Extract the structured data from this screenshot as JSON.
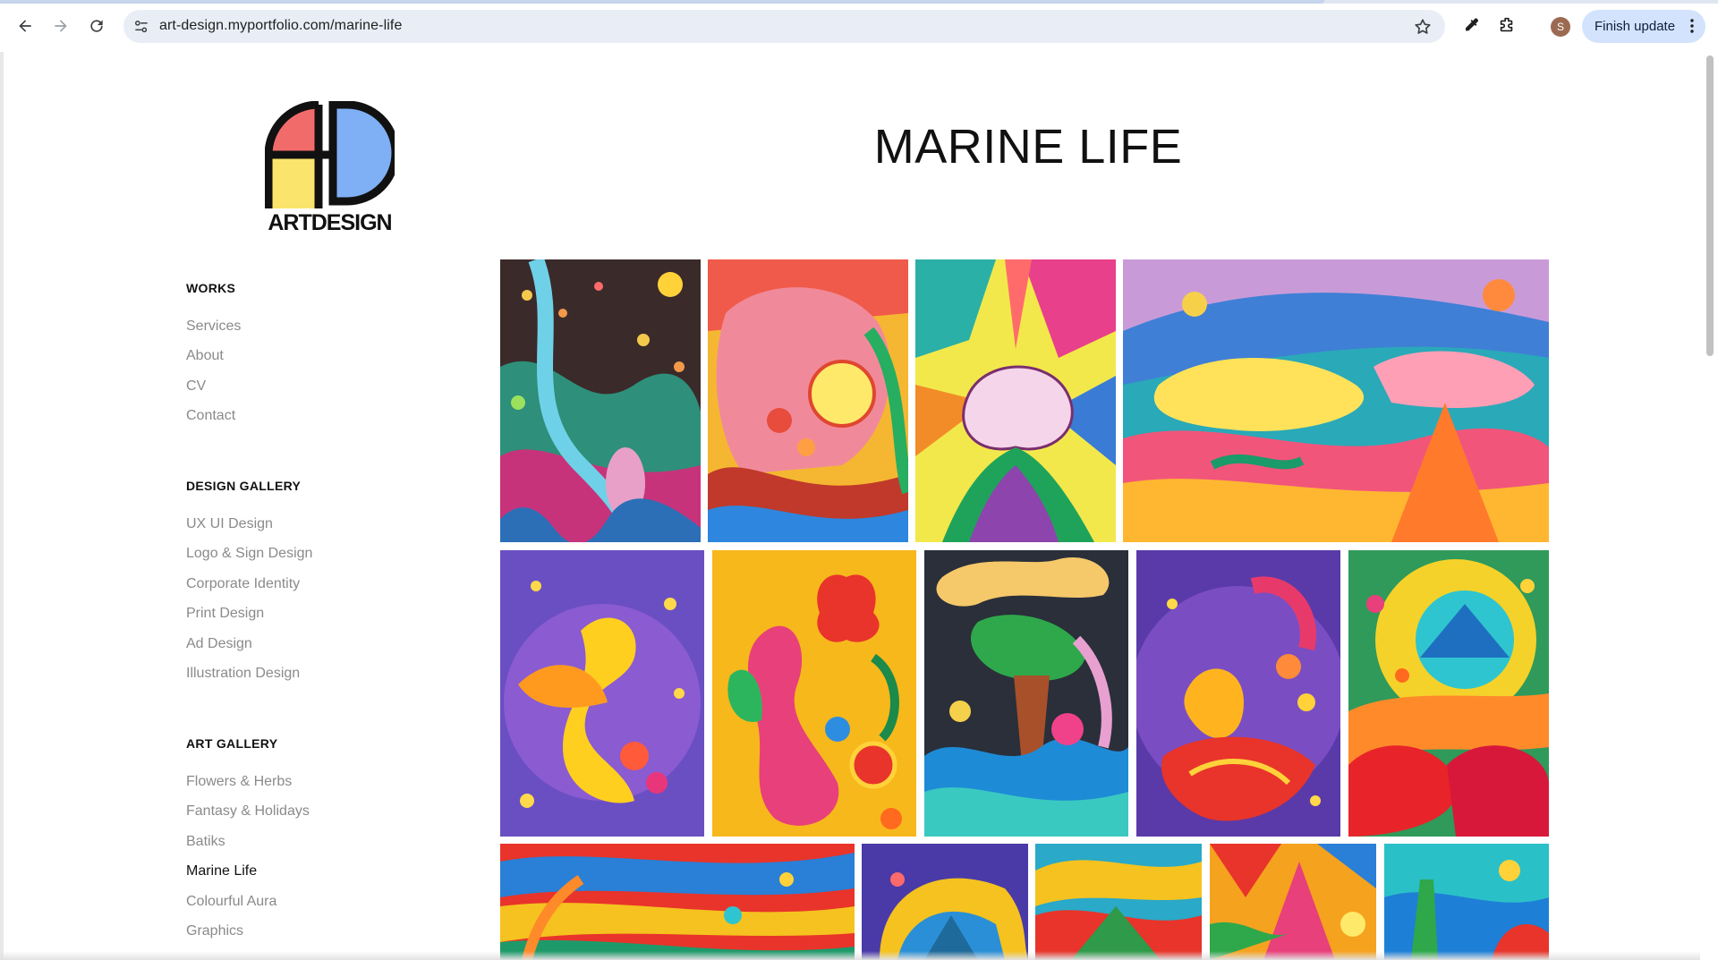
{
  "browser": {
    "url": "art-design.myportfolio.com/marine-life",
    "profile_initial": "S",
    "finish_update_label": "Finish update"
  },
  "logo": {
    "text": "ARTDESIGN"
  },
  "sidebar": {
    "sections": [
      {
        "title": "WORKS",
        "items": [
          "Services",
          "About",
          "CV",
          "Contact"
        ]
      },
      {
        "title": "DESIGN GALLERY",
        "items": [
          "UX UI Design",
          "Logo & Sign Design",
          "Corporate Identity",
          "Print Design",
          "Ad Design",
          "Illustration Design"
        ]
      },
      {
        "title": "ART GALLERY",
        "items": [
          "Flowers & Herbs",
          "Fantasy & Holidays",
          "Batiks",
          "Marine Life",
          "Colourful Aura",
          "Graphics"
        ]
      }
    ],
    "active_item": "Marine Life"
  },
  "main": {
    "title": "MARINE LIFE"
  },
  "colors": {
    "logo_red": "#f26b6b",
    "logo_yellow": "#fbe46b",
    "logo_blue": "#7fb0f5",
    "chrome_button": "#d3e3fd"
  },
  "icons": [
    "back-arrow-icon",
    "forward-arrow-icon",
    "reload-icon",
    "site-settings-icon",
    "bookmark-star-icon",
    "eyedropper-icon",
    "extensions-icon",
    "more-vert-icon"
  ]
}
